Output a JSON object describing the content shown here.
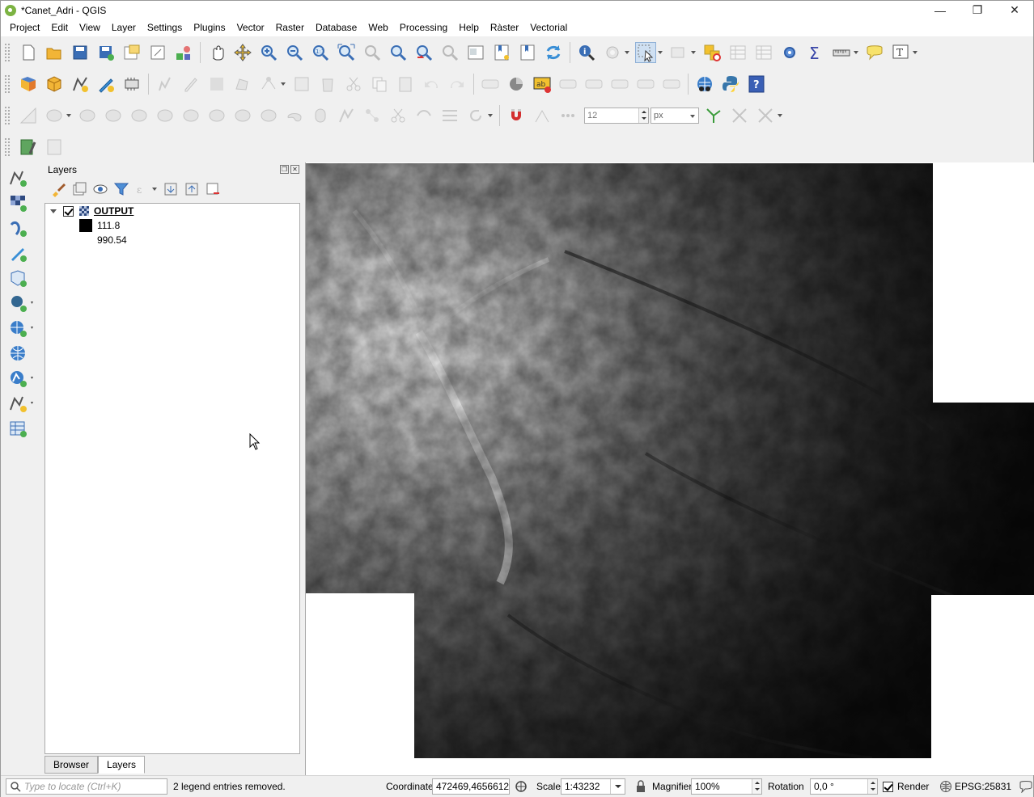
{
  "window": {
    "title": "*Canet_Adri - QGIS"
  },
  "menu": [
    "Project",
    "Edit",
    "View",
    "Layer",
    "Settings",
    "Plugins",
    "Vector",
    "Raster",
    "Database",
    "Web",
    "Processing",
    "Help",
    "Ràster",
    "Vectorial"
  ],
  "toolbar3": {
    "snap_tolerance": "12",
    "snap_unit": "px"
  },
  "layers_panel": {
    "title": "Layers",
    "layer": {
      "name": "OUTPUT",
      "checked": true
    },
    "legend": [
      {
        "label": "111.8",
        "color": "#000000"
      },
      {
        "label": "990.54",
        "color": "#ffffff"
      }
    ],
    "tabs": [
      "Browser",
      "Layers"
    ],
    "active_tab": "Layers"
  },
  "status": {
    "locator_placeholder": "Type to locate (Ctrl+K)",
    "message": "2 legend entries removed.",
    "coordinate_label": "Coordinate",
    "coordinate": "472469,4656612",
    "scale_label": "Scale",
    "scale": "1:43232",
    "magnifier_label": "Magnifier",
    "magnifier": "100%",
    "rotation_label": "Rotation",
    "rotation": "0,0 °",
    "render_label": "Render",
    "crs": "EPSG:25831"
  }
}
